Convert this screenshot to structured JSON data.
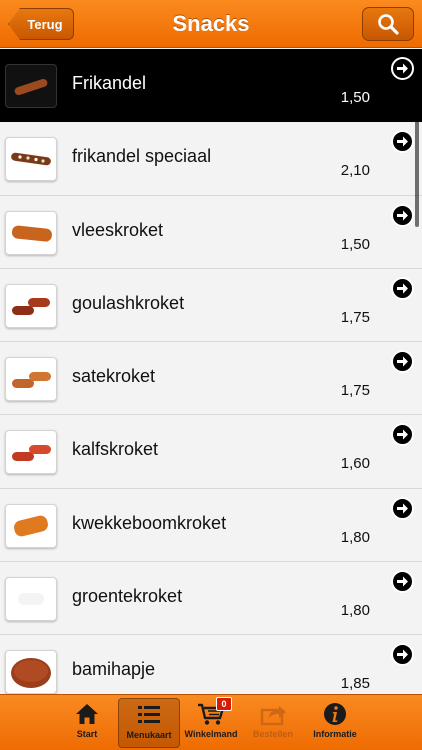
{
  "nav": {
    "back_label": "Terug",
    "title": "Snacks"
  },
  "items": [
    {
      "name": "Frikandel",
      "price": "1,50"
    },
    {
      "name": "frikandel speciaal",
      "price": "2,10"
    },
    {
      "name": "vleeskroket",
      "price": "1,50"
    },
    {
      "name": "goulashkroket",
      "price": "1,75"
    },
    {
      "name": "satekroket",
      "price": "1,75"
    },
    {
      "name": "kalfskroket",
      "price": "1,60"
    },
    {
      "name": "kwekkeboomkroket",
      "price": "1,80"
    },
    {
      "name": "groentekroket",
      "price": "1,80"
    },
    {
      "name": "bamihapje",
      "price": "1,85"
    }
  ],
  "tabs": {
    "start": "Start",
    "menu": "Menukaart",
    "cart": "Winkelmand",
    "cart_count": "0",
    "order": "Bestellen",
    "info": "Informatie"
  },
  "colors": {
    "accent": "#f07a10",
    "selected_row": "#000000"
  }
}
